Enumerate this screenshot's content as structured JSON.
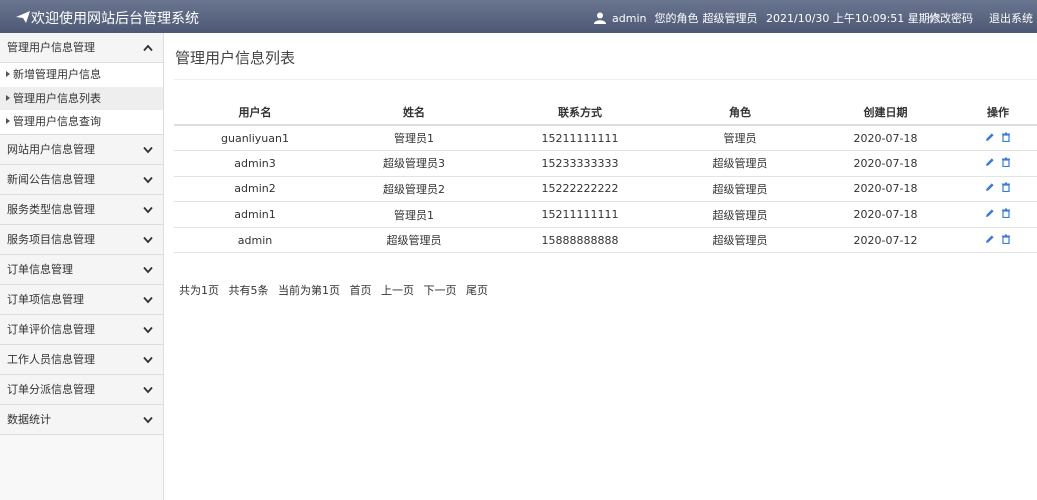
{
  "header": {
    "title": "欢迎使用网站后台管理系统",
    "username": "admin",
    "role_label": "您的角色",
    "role": "超级管理员",
    "datetime": "2021/10/30 上午10:09:51 星期六",
    "change_password": "修改密码",
    "logout": "退出系统"
  },
  "sidebar": {
    "groups": [
      {
        "label": "管理用户信息管理",
        "expanded": true,
        "items": [
          "新增管理用户信息",
          "管理用户信息列表",
          "管理用户信息查询"
        ]
      },
      {
        "label": "网站用户信息管理"
      },
      {
        "label": "新闻公告信息管理"
      },
      {
        "label": "服务类型信息管理"
      },
      {
        "label": "服务项目信息管理"
      },
      {
        "label": "订单信息管理"
      },
      {
        "label": "订单项信息管理"
      },
      {
        "label": "订单评价信息管理"
      },
      {
        "label": "工作人员信息管理"
      },
      {
        "label": "订单分派信息管理"
      },
      {
        "label": "数据统计"
      }
    ]
  },
  "main": {
    "title": "管理用户信息列表",
    "columns": [
      "用户名",
      "姓名",
      "联系方式",
      "角色",
      "创建日期",
      "操作"
    ],
    "rows": [
      [
        "guanliyuan1",
        "管理员1",
        "15211111111",
        "管理员",
        "2020-07-18"
      ],
      [
        "admin3",
        "超级管理员3",
        "15233333333",
        "超级管理员",
        "2020-07-18"
      ],
      [
        "admin2",
        "超级管理员2",
        "15222222222",
        "超级管理员",
        "2020-07-18"
      ],
      [
        "admin1",
        "管理员1",
        "15211111111",
        "超级管理员",
        "2020-07-18"
      ],
      [
        "admin",
        "超级管理员",
        "15888888888",
        "超级管理员",
        "2020-07-12"
      ]
    ],
    "pager": {
      "total_pages": "共为1页",
      "total_records": "共有5条",
      "current": "当前为第1页",
      "first": "首页",
      "prev": "上一页",
      "next": "下一页",
      "last": "尾页"
    }
  },
  "colors": {
    "header_bg": "#5a6580",
    "icon_blue": "#3a7bd5"
  }
}
